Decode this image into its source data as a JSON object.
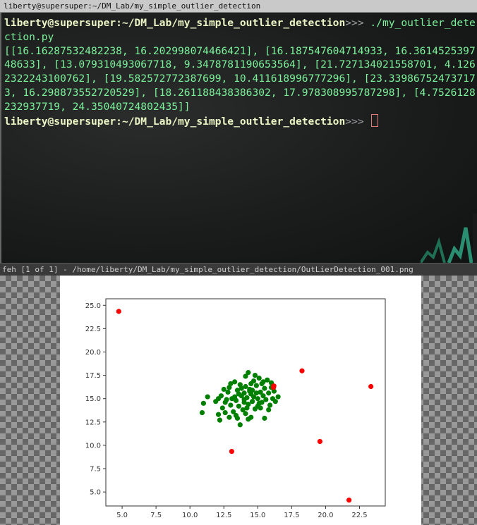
{
  "terminal_window": {
    "title": "liberty@supersuper:~/DM_Lab/my_simple_outlier_detection",
    "prompt_user_host": "liberty@supersuper",
    "prompt_path": ":~/DM_Lab/my_simple_outlier_detection",
    "prompt_symbol": ">>>",
    "command": " ./my_outlier_detection.py",
    "output": "[[16.16287532482238, 16.202998074466421], [16.187547604714933, 16.361452539748633], [13.079310493067718, 9.3478781190653564], [21.727134021558701, 4.1262322243100762], [19.582572772387699, 10.411618996777296], [23.339867524737173, 16.298873552720529], [18.261188438386302, 17.978308995787298], [4.7526128232937719, 24.35040724802435]]"
  },
  "image_viewer": {
    "title": "feh [1 of 1] - /home/liberty/DM_Lab/my_simple_outlier_detection/OutLierDetection_001.png"
  },
  "chart_data": {
    "type": "scatter",
    "title": "",
    "xlabel": "",
    "ylabel": "",
    "xlim": [
      3.8,
      24.4
    ],
    "ylim": [
      3.5,
      25.7
    ],
    "x_ticks": [
      "5.0",
      "7.5",
      "10.0",
      "12.5",
      "15.0",
      "17.5",
      "20.0",
      "22.5"
    ],
    "x_tick_values": [
      5.0,
      7.5,
      10.0,
      12.5,
      15.0,
      17.5,
      20.0,
      22.5
    ],
    "y_ticks": [
      "5.0",
      "7.5",
      "10.0",
      "12.5",
      "15.0",
      "17.5",
      "20.0",
      "22.5",
      "25.0"
    ],
    "y_tick_values": [
      5.0,
      7.5,
      10.0,
      12.5,
      15.0,
      17.5,
      20.0,
      22.5,
      25.0
    ],
    "grid": false,
    "series": [
      {
        "color": "#008000",
        "points": [
          [
            10.9,
            13.5
          ],
          [
            11.0,
            14.5
          ],
          [
            11.3,
            15.2
          ],
          [
            11.9,
            14.7
          ],
          [
            12.1,
            13.3
          ],
          [
            12.2,
            12.7
          ],
          [
            12.3,
            15.3
          ],
          [
            12.4,
            14.0
          ],
          [
            12.5,
            16.0
          ],
          [
            12.6,
            14.6
          ],
          [
            12.8,
            15.7
          ],
          [
            12.9,
            13.0
          ],
          [
            12.9,
            16.2
          ],
          [
            13.0,
            14.3
          ],
          [
            13.1,
            15.0
          ],
          [
            13.2,
            13.6
          ],
          [
            13.3,
            16.8
          ],
          [
            13.4,
            14.8
          ],
          [
            13.5,
            12.9
          ],
          [
            13.5,
            15.9
          ],
          [
            13.6,
            14.2
          ],
          [
            13.7,
            16.5
          ],
          [
            13.7,
            12.2
          ],
          [
            13.8,
            15.3
          ],
          [
            13.9,
            13.8
          ],
          [
            14.0,
            15.6
          ],
          [
            14.0,
            14.9
          ],
          [
            14.1,
            16.3
          ],
          [
            14.1,
            13.4
          ],
          [
            14.2,
            15.1
          ],
          [
            14.3,
            17.8
          ],
          [
            14.3,
            14.4
          ],
          [
            14.4,
            16.0
          ],
          [
            14.5,
            15.5
          ],
          [
            14.5,
            13.0
          ],
          [
            14.6,
            14.7
          ],
          [
            14.7,
            16.9
          ],
          [
            14.7,
            15.2
          ],
          [
            14.8,
            13.9
          ],
          [
            14.9,
            16.4
          ],
          [
            15.0,
            15.0
          ],
          [
            15.0,
            14.2
          ],
          [
            15.1,
            17.2
          ],
          [
            15.2,
            15.7
          ],
          [
            15.3,
            16.6
          ],
          [
            15.3,
            14.6
          ],
          [
            15.4,
            15.3
          ],
          [
            15.5,
            12.9
          ],
          [
            15.5,
            16.1
          ],
          [
            15.6,
            14.9
          ],
          [
            15.7,
            17.0
          ],
          [
            15.8,
            15.6
          ],
          [
            15.9,
            14.3
          ],
          [
            16.0,
            16.2
          ],
          [
            16.1,
            15.0
          ],
          [
            16.2,
            15.8
          ],
          [
            16.3,
            14.7
          ],
          [
            16.5,
            15.2
          ],
          [
            13.3,
            15.2
          ],
          [
            13.6,
            15.5
          ],
          [
            14.0,
            14.6
          ],
          [
            14.2,
            14.0
          ],
          [
            14.4,
            15.8
          ],
          [
            14.6,
            15.9
          ],
          [
            14.9,
            15.6
          ],
          [
            15.1,
            14.5
          ],
          [
            13.8,
            16.1
          ],
          [
            14.1,
            17.4
          ],
          [
            12.6,
            13.5
          ],
          [
            13.0,
            16.6
          ],
          [
            14.8,
            17.5
          ],
          [
            15.4,
            16.8
          ],
          [
            12.1,
            15.0
          ],
          [
            13.4,
            13.2
          ],
          [
            15.8,
            13.8
          ],
          [
            14.3,
            12.8
          ],
          [
            12.7,
            14.9
          ],
          [
            16.0,
            16.7
          ],
          [
            14.5,
            16.6
          ],
          [
            15.2,
            14.0
          ]
        ]
      },
      {
        "color": "#ff0000",
        "points": [
          [
            16.16287532482238,
            16.20299807446642
          ],
          [
            16.187547604714933,
            16.361452539748633
          ],
          [
            13.079310493067718,
            9.347878119065356
          ],
          [
            21.7271340215587,
            4.126232224310076
          ],
          [
            19.5825727723877,
            10.411618996777296
          ],
          [
            23.339867524737173,
            16.29887355272053
          ],
          [
            18.261188438386302,
            17.978308995787298
          ],
          [
            4.752612823293772,
            24.35040724802435
          ]
        ]
      }
    ]
  }
}
